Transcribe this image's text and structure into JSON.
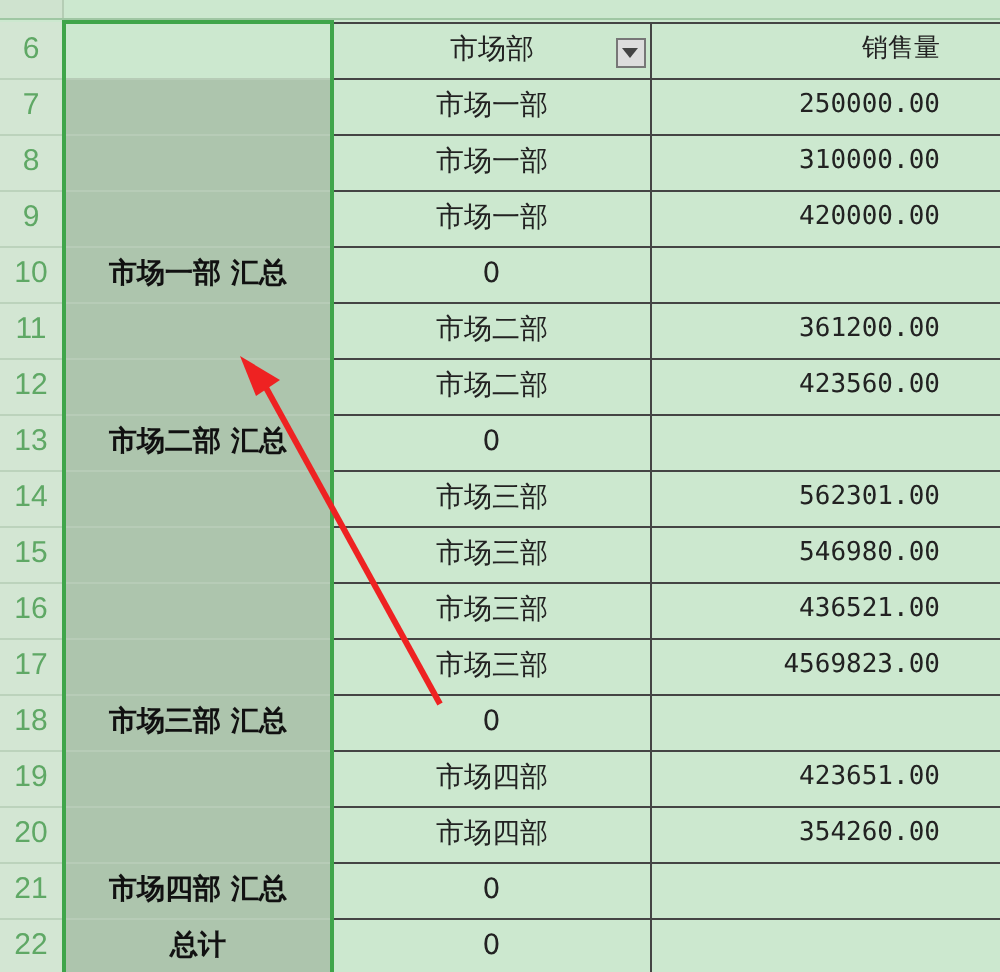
{
  "columns": [
    {
      "selected": true
    },
    {
      "selected": false
    },
    {
      "selected": false
    }
  ],
  "header": {
    "row": "6",
    "cells": [
      "",
      "市场部",
      "销售量"
    ],
    "filter": true
  },
  "rows": [
    {
      "row": "7",
      "cells": [
        "",
        "市场一部",
        "250000.00"
      ]
    },
    {
      "row": "8",
      "cells": [
        "",
        "市场一部",
        "310000.00"
      ]
    },
    {
      "row": "9",
      "cells": [
        "",
        "市场一部",
        "420000.00"
      ]
    },
    {
      "row": "10",
      "cells": [
        "市场一部 汇总",
        "0",
        ""
      ]
    },
    {
      "row": "11",
      "cells": [
        "",
        "市场二部",
        "361200.00"
      ]
    },
    {
      "row": "12",
      "cells": [
        "",
        "市场二部",
        "423560.00"
      ]
    },
    {
      "row": "13",
      "cells": [
        "市场二部 汇总",
        "0",
        ""
      ]
    },
    {
      "row": "14",
      "cells": [
        "",
        "市场三部",
        "562301.00"
      ]
    },
    {
      "row": "15",
      "cells": [
        "",
        "市场三部",
        "546980.00"
      ]
    },
    {
      "row": "16",
      "cells": [
        "",
        "市场三部",
        "436521.00"
      ]
    },
    {
      "row": "17",
      "cells": [
        "",
        "市场三部",
        "4569823.00"
      ]
    },
    {
      "row": "18",
      "cells": [
        "市场三部 汇总",
        "0",
        ""
      ]
    },
    {
      "row": "19",
      "cells": [
        "",
        "市场四部",
        "423651.00"
      ]
    },
    {
      "row": "20",
      "cells": [
        "",
        "市场四部",
        "354260.00"
      ]
    },
    {
      "row": "21",
      "cells": [
        "市场四部 汇总",
        "0",
        ""
      ]
    },
    {
      "row": "22",
      "cells": [
        "总计",
        "0",
        ""
      ]
    }
  ]
}
